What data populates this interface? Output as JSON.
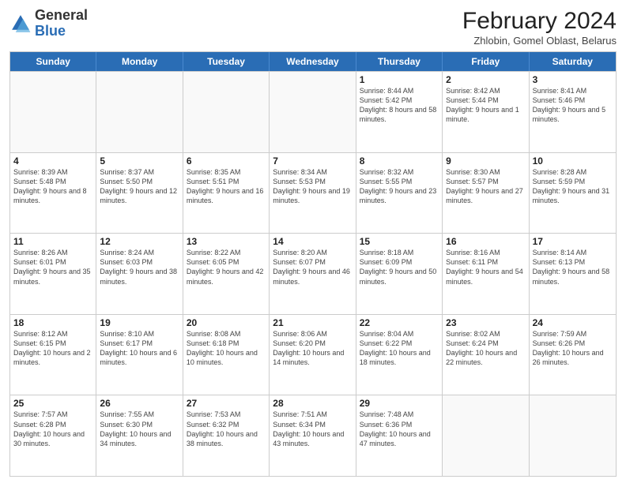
{
  "header": {
    "logo": {
      "general": "General",
      "blue": "Blue"
    },
    "title": "February 2024",
    "location": "Zhlobin, Gomel Oblast, Belarus"
  },
  "days_of_week": [
    "Sunday",
    "Monday",
    "Tuesday",
    "Wednesday",
    "Thursday",
    "Friday",
    "Saturday"
  ],
  "rows": [
    [
      {
        "day": "",
        "info": ""
      },
      {
        "day": "",
        "info": ""
      },
      {
        "day": "",
        "info": ""
      },
      {
        "day": "",
        "info": ""
      },
      {
        "day": "1",
        "info": "Sunrise: 8:44 AM\nSunset: 5:42 PM\nDaylight: 8 hours and 58 minutes."
      },
      {
        "day": "2",
        "info": "Sunrise: 8:42 AM\nSunset: 5:44 PM\nDaylight: 9 hours and 1 minute."
      },
      {
        "day": "3",
        "info": "Sunrise: 8:41 AM\nSunset: 5:46 PM\nDaylight: 9 hours and 5 minutes."
      }
    ],
    [
      {
        "day": "4",
        "info": "Sunrise: 8:39 AM\nSunset: 5:48 PM\nDaylight: 9 hours and 8 minutes."
      },
      {
        "day": "5",
        "info": "Sunrise: 8:37 AM\nSunset: 5:50 PM\nDaylight: 9 hours and 12 minutes."
      },
      {
        "day": "6",
        "info": "Sunrise: 8:35 AM\nSunset: 5:51 PM\nDaylight: 9 hours and 16 minutes."
      },
      {
        "day": "7",
        "info": "Sunrise: 8:34 AM\nSunset: 5:53 PM\nDaylight: 9 hours and 19 minutes."
      },
      {
        "day": "8",
        "info": "Sunrise: 8:32 AM\nSunset: 5:55 PM\nDaylight: 9 hours and 23 minutes."
      },
      {
        "day": "9",
        "info": "Sunrise: 8:30 AM\nSunset: 5:57 PM\nDaylight: 9 hours and 27 minutes."
      },
      {
        "day": "10",
        "info": "Sunrise: 8:28 AM\nSunset: 5:59 PM\nDaylight: 9 hours and 31 minutes."
      }
    ],
    [
      {
        "day": "11",
        "info": "Sunrise: 8:26 AM\nSunset: 6:01 PM\nDaylight: 9 hours and 35 minutes."
      },
      {
        "day": "12",
        "info": "Sunrise: 8:24 AM\nSunset: 6:03 PM\nDaylight: 9 hours and 38 minutes."
      },
      {
        "day": "13",
        "info": "Sunrise: 8:22 AM\nSunset: 6:05 PM\nDaylight: 9 hours and 42 minutes."
      },
      {
        "day": "14",
        "info": "Sunrise: 8:20 AM\nSunset: 6:07 PM\nDaylight: 9 hours and 46 minutes."
      },
      {
        "day": "15",
        "info": "Sunrise: 8:18 AM\nSunset: 6:09 PM\nDaylight: 9 hours and 50 minutes."
      },
      {
        "day": "16",
        "info": "Sunrise: 8:16 AM\nSunset: 6:11 PM\nDaylight: 9 hours and 54 minutes."
      },
      {
        "day": "17",
        "info": "Sunrise: 8:14 AM\nSunset: 6:13 PM\nDaylight: 9 hours and 58 minutes."
      }
    ],
    [
      {
        "day": "18",
        "info": "Sunrise: 8:12 AM\nSunset: 6:15 PM\nDaylight: 10 hours and 2 minutes."
      },
      {
        "day": "19",
        "info": "Sunrise: 8:10 AM\nSunset: 6:17 PM\nDaylight: 10 hours and 6 minutes."
      },
      {
        "day": "20",
        "info": "Sunrise: 8:08 AM\nSunset: 6:18 PM\nDaylight: 10 hours and 10 minutes."
      },
      {
        "day": "21",
        "info": "Sunrise: 8:06 AM\nSunset: 6:20 PM\nDaylight: 10 hours and 14 minutes."
      },
      {
        "day": "22",
        "info": "Sunrise: 8:04 AM\nSunset: 6:22 PM\nDaylight: 10 hours and 18 minutes."
      },
      {
        "day": "23",
        "info": "Sunrise: 8:02 AM\nSunset: 6:24 PM\nDaylight: 10 hours and 22 minutes."
      },
      {
        "day": "24",
        "info": "Sunrise: 7:59 AM\nSunset: 6:26 PM\nDaylight: 10 hours and 26 minutes."
      }
    ],
    [
      {
        "day": "25",
        "info": "Sunrise: 7:57 AM\nSunset: 6:28 PM\nDaylight: 10 hours and 30 minutes."
      },
      {
        "day": "26",
        "info": "Sunrise: 7:55 AM\nSunset: 6:30 PM\nDaylight: 10 hours and 34 minutes."
      },
      {
        "day": "27",
        "info": "Sunrise: 7:53 AM\nSunset: 6:32 PM\nDaylight: 10 hours and 38 minutes."
      },
      {
        "day": "28",
        "info": "Sunrise: 7:51 AM\nSunset: 6:34 PM\nDaylight: 10 hours and 43 minutes."
      },
      {
        "day": "29",
        "info": "Sunrise: 7:48 AM\nSunset: 6:36 PM\nDaylight: 10 hours and 47 minutes."
      },
      {
        "day": "",
        "info": ""
      },
      {
        "day": "",
        "info": ""
      }
    ]
  ]
}
